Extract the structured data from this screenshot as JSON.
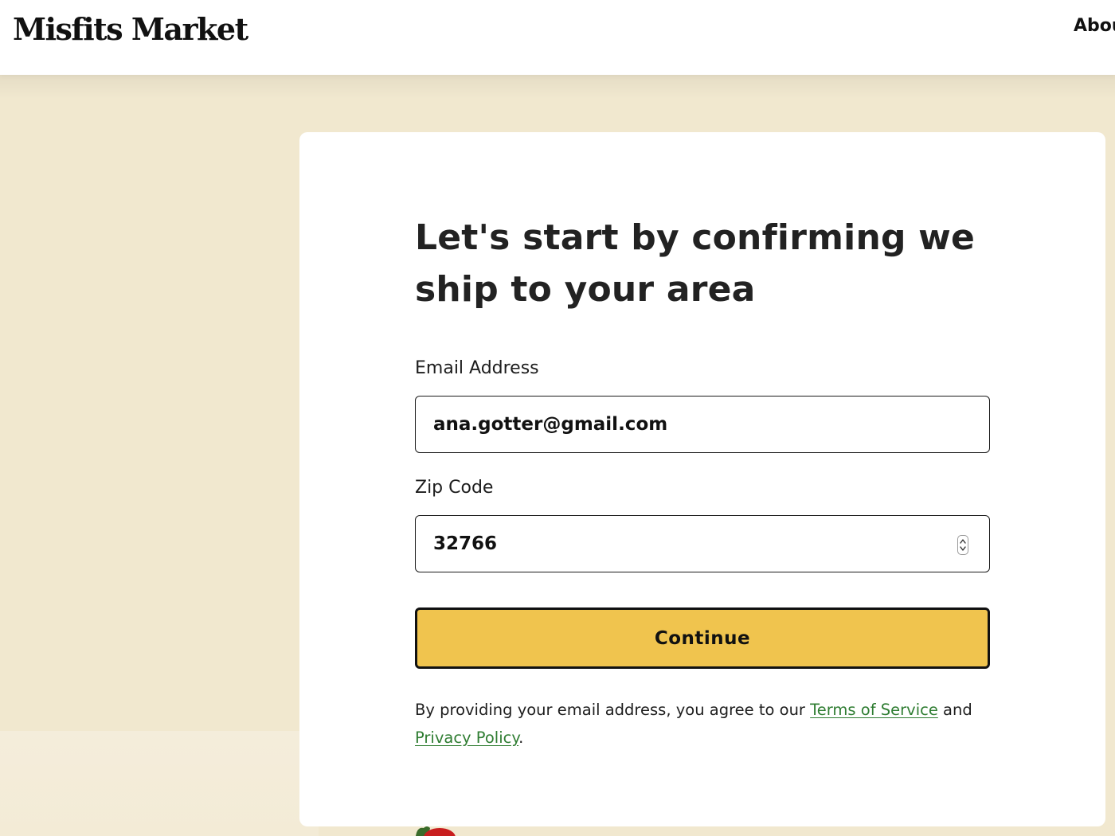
{
  "header": {
    "logo_text": "Misfits Market",
    "nav_about": "Abou"
  },
  "form": {
    "heading": "Let's start by confirming we ship to your area",
    "email": {
      "label": "Email Address",
      "value": "ana.gotter@gmail.com"
    },
    "zip": {
      "label": "Zip Code",
      "value": "32766"
    },
    "continue_label": "Continue"
  },
  "legal": {
    "text_before": "By providing your email address, you agree to our ",
    "terms_link": "Terms of Service",
    "text_middle": " and",
    "privacy_link": "Privacy Policy",
    "text_after": "."
  },
  "colors": {
    "page_background": "#f1e8cf",
    "button_yellow": "#f0c44e",
    "link_green": "#2f7d32",
    "card_background": "#ffffff"
  },
  "icons": {
    "zip_spinner": "up-down-chevron-icon",
    "produce": "tomato-icon"
  }
}
